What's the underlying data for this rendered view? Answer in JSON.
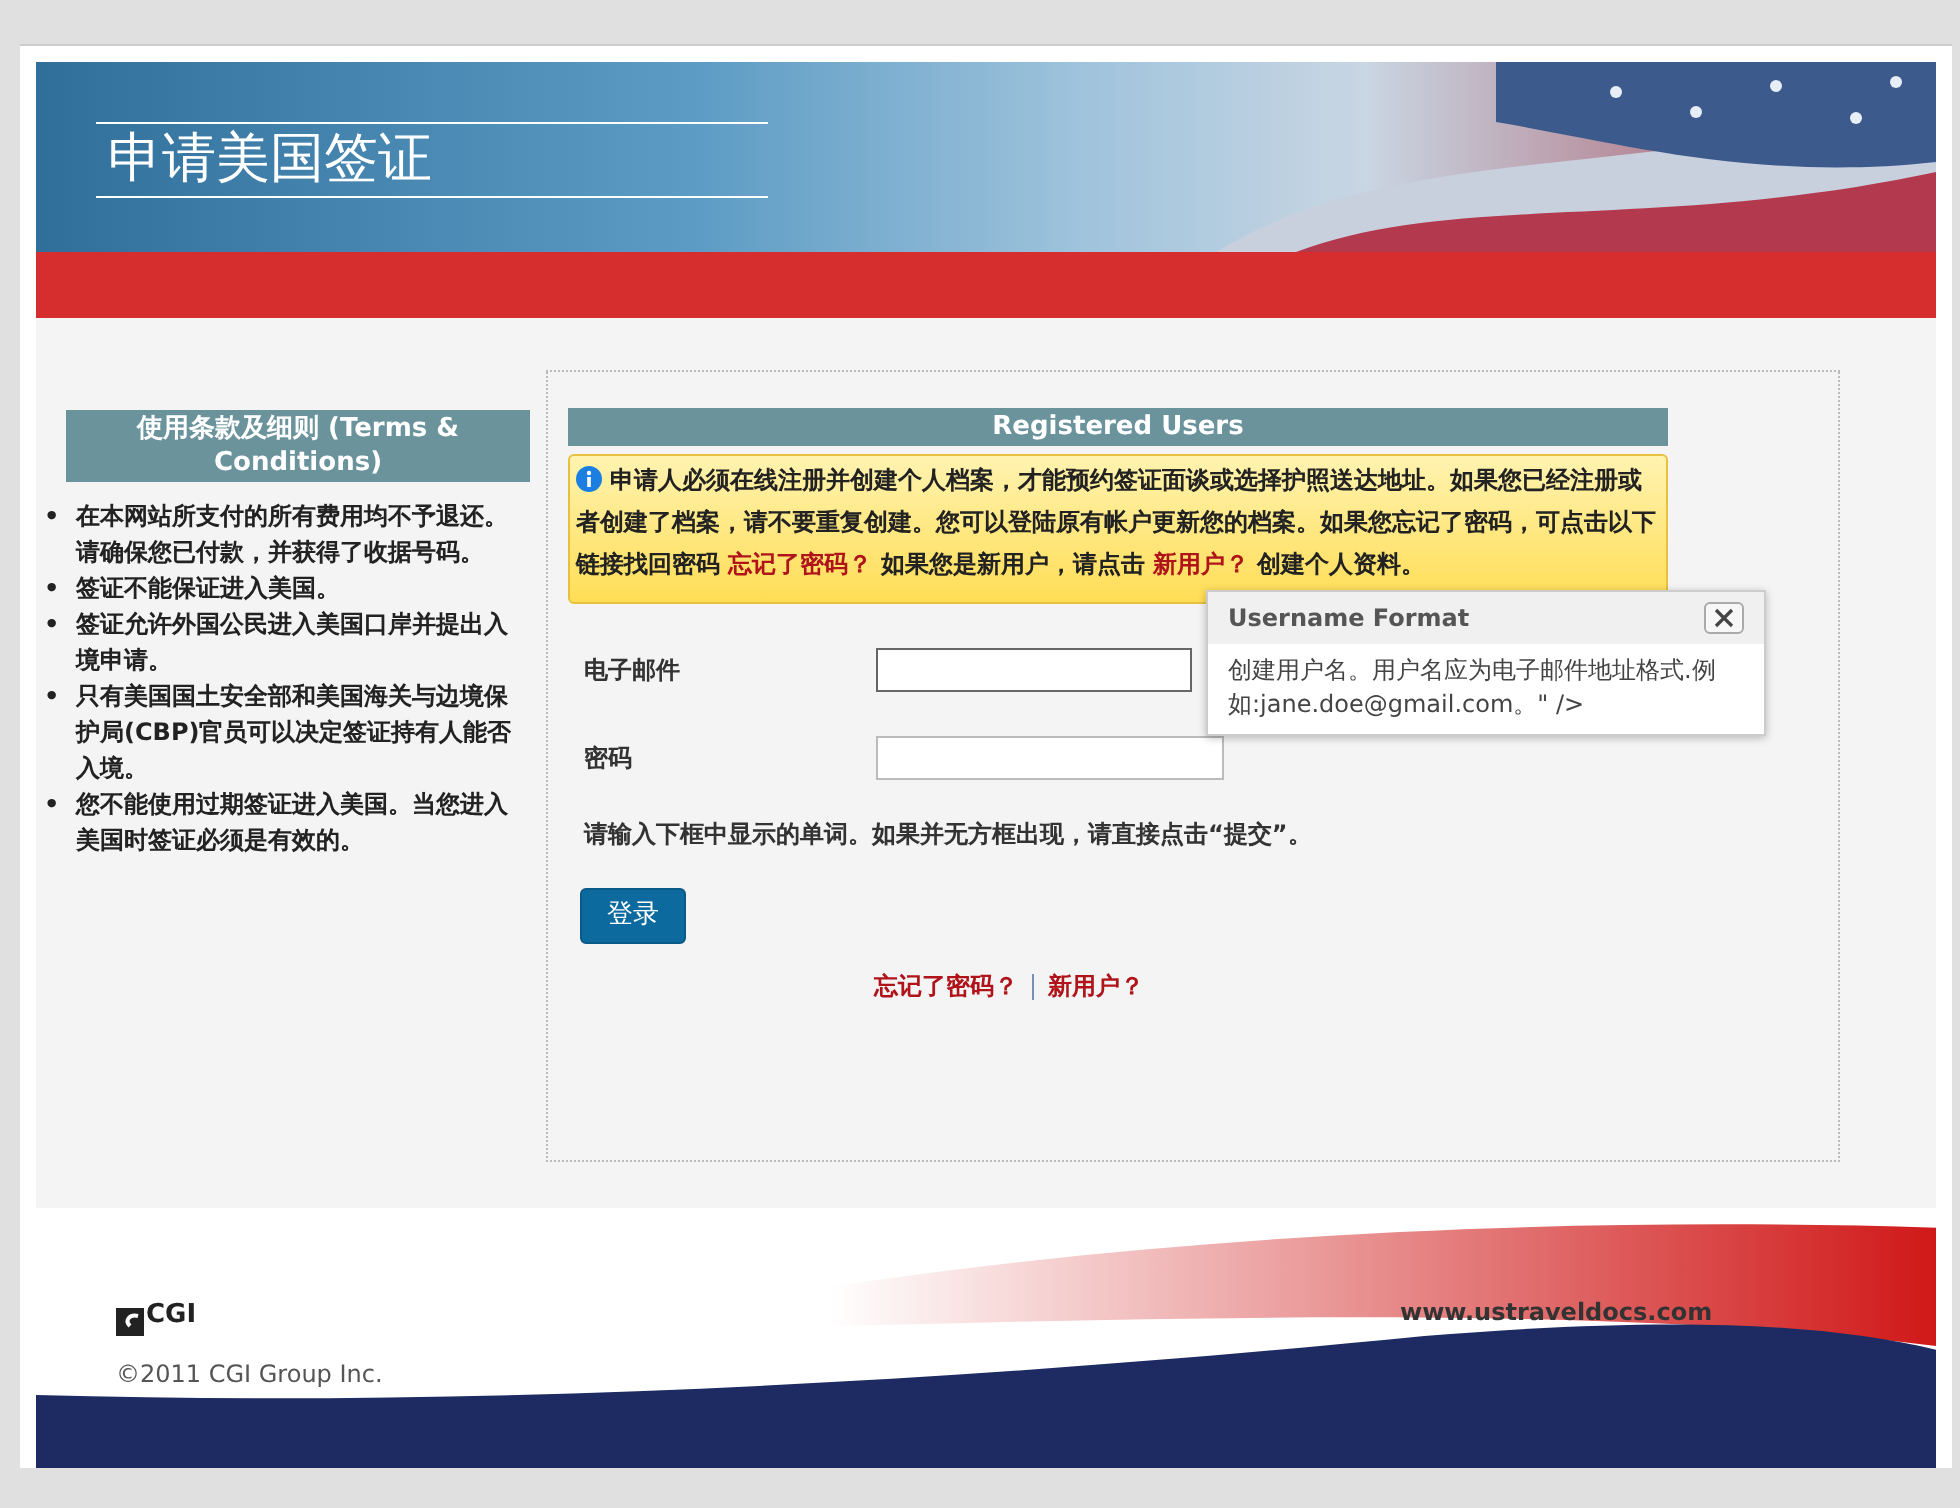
{
  "header": {
    "title": "申请美国签证"
  },
  "terms": {
    "heading": "使用条款及细则 (Terms & Conditions)",
    "items": [
      {
        "marker": "•",
        "text": "在本网站所支付的所有费用均不予退还。请确保您已付款，并获得了收据号码。"
      },
      {
        "marker": "•",
        "text": "签证不能保证进入美国。"
      },
      {
        "marker": "•",
        "text": "签证允许外国公民进入美国口岸并提出入境申请。"
      },
      {
        "marker": "•",
        "text": "只有美国国土安全部和美国海关与边境保护局(CBP)官员可以决定签证持有人能否入境。"
      },
      {
        "marker": "•",
        "text": "您不能使用过期签证进入美国。当您进入美国时签证必须是有效的。"
      }
    ]
  },
  "login": {
    "heading": "Registered Users",
    "notice": [
      {
        "kind": "text",
        "text": "申请人必须在线注册并创建个人档案，才能预约签证面谈或选择护照送达地址。如果您已经注册或者创建了档案，请不要重复创建。您可以登陆原有帐户更新您的档案。如果您忘记了密码，可点击以下链接找回密码 "
      },
      {
        "kind": "link",
        "text": "忘记了密码？"
      },
      {
        "kind": "text",
        "text": " 如果您是新用户，请点击 "
      },
      {
        "kind": "link",
        "text": "新用户？"
      },
      {
        "kind": "text",
        "text": " 创建个人资料。"
      }
    ],
    "fields": [
      {
        "label": "电子邮件",
        "focused": true
      },
      {
        "label": "密码",
        "focused": false
      }
    ],
    "captcha_hint": "请输入下框中显示的单词。如果并无方框出现，请直接点击“提交”。",
    "submit": "登录",
    "links": [
      "忘记了密码？",
      "新用户？"
    ]
  },
  "popover": {
    "title": "Username Format",
    "body": "创建用户名。用户名应为电子邮件地址格式.例如:jane.doe@gmail.com。\" />"
  },
  "footer": {
    "logo": "CGI",
    "copyright": "©2011 CGI Group Inc.",
    "url": "www.ustraveldocs.com"
  }
}
